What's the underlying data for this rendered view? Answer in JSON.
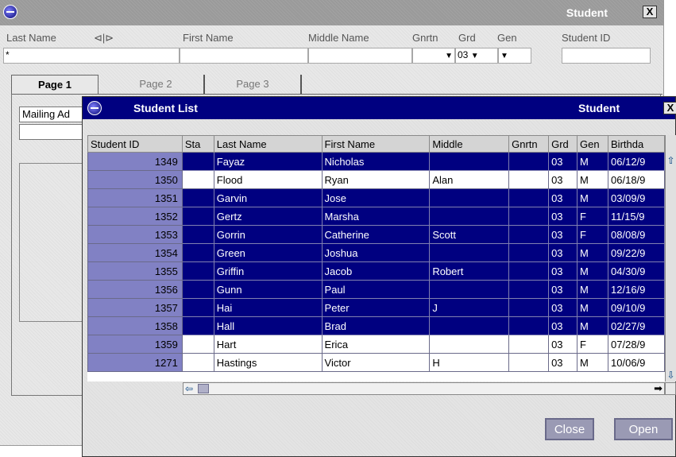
{
  "background_window": {
    "title": "Student",
    "close_glyph": "X",
    "fields": {
      "last_name_label": "Last Name",
      "last_name_arrow": "⊲|⊳",
      "first_name_label": "First Name",
      "middle_name_label": "Middle Name",
      "gnrtn_label": "Gnrtn",
      "grd_label": "Grd",
      "gen_label": "Gen",
      "student_id_label": "Student ID",
      "last_name_value": "*",
      "grd_value": "03"
    },
    "tabs": [
      "Page 1",
      "Page 2",
      "Page 3"
    ],
    "mailing_label": "Mailing Ad"
  },
  "dialog": {
    "title": "Student List",
    "title_right": "Student",
    "close_glyph": "X",
    "columns": [
      "Student ID",
      "Sta",
      "Last Name",
      "First Name",
      "Middle",
      "Gnrtn",
      "Grd",
      "Gen",
      "Birthda"
    ],
    "rows": [
      {
        "id": "1349",
        "sta": "",
        "last": "Fayaz",
        "first": "Nicholas",
        "middle": "",
        "gnrtn": "",
        "grd": "03",
        "gen": "M",
        "birth": "06/12/9",
        "selected": true
      },
      {
        "id": "1350",
        "sta": "",
        "last": "Flood",
        "first": "Ryan",
        "middle": "Alan",
        "gnrtn": "",
        "grd": "03",
        "gen": "M",
        "birth": "06/18/9",
        "selected": false
      },
      {
        "id": "1351",
        "sta": "",
        "last": "Garvin",
        "first": "Jose",
        "middle": "",
        "gnrtn": "",
        "grd": "03",
        "gen": "M",
        "birth": "03/09/9",
        "selected": true
      },
      {
        "id": "1352",
        "sta": "",
        "last": "Gertz",
        "first": "Marsha",
        "middle": "",
        "gnrtn": "",
        "grd": "03",
        "gen": "F",
        "birth": "11/15/9",
        "selected": true
      },
      {
        "id": "1353",
        "sta": "",
        "last": "Gorrin",
        "first": "Catherine",
        "middle": "Scott",
        "gnrtn": "",
        "grd": "03",
        "gen": "F",
        "birth": "08/08/9",
        "selected": true
      },
      {
        "id": "1354",
        "sta": "",
        "last": "Green",
        "first": "Joshua",
        "middle": "",
        "gnrtn": "",
        "grd": "03",
        "gen": "M",
        "birth": "09/22/9",
        "selected": true
      },
      {
        "id": "1355",
        "sta": "",
        "last": "Griffin",
        "first": "Jacob",
        "middle": "Robert",
        "gnrtn": "",
        "grd": "03",
        "gen": "M",
        "birth": "04/30/9",
        "selected": true
      },
      {
        "id": "1356",
        "sta": "",
        "last": "Gunn",
        "first": "Paul",
        "middle": "",
        "gnrtn": "",
        "grd": "03",
        "gen": "M",
        "birth": "12/16/9",
        "selected": true
      },
      {
        "id": "1357",
        "sta": "",
        "last": "Hai",
        "first": "Peter",
        "middle": "J",
        "gnrtn": "",
        "grd": "03",
        "gen": "M",
        "birth": "09/10/9",
        "selected": true
      },
      {
        "id": "1358",
        "sta": "",
        "last": "Hall",
        "first": "Brad",
        "middle": "",
        "gnrtn": "",
        "grd": "03",
        "gen": "M",
        "birth": "02/27/9",
        "selected": true
      },
      {
        "id": "1359",
        "sta": "",
        "last": "Hart",
        "first": "Erica",
        "middle": "",
        "gnrtn": "",
        "grd": "03",
        "gen": "F",
        "birth": "07/28/9",
        "selected": false
      },
      {
        "id": "1271",
        "sta": "",
        "last": "Hastings",
        "first": "Victor",
        "middle": "H",
        "gnrtn": "",
        "grd": "03",
        "gen": "M",
        "birth": "10/06/9",
        "selected": false
      }
    ],
    "buttons": {
      "close": "Close",
      "open": "Open"
    }
  },
  "colors": {
    "selection": "#000080",
    "id_cell": "#8181c4",
    "button": "#9a9ab4"
  },
  "icons": [
    "app-icon",
    "close-icon",
    "scroll-up-icon",
    "scroll-down-icon",
    "scroll-left-icon",
    "scroll-right-icon",
    "dropdown-arrow-icon"
  ]
}
